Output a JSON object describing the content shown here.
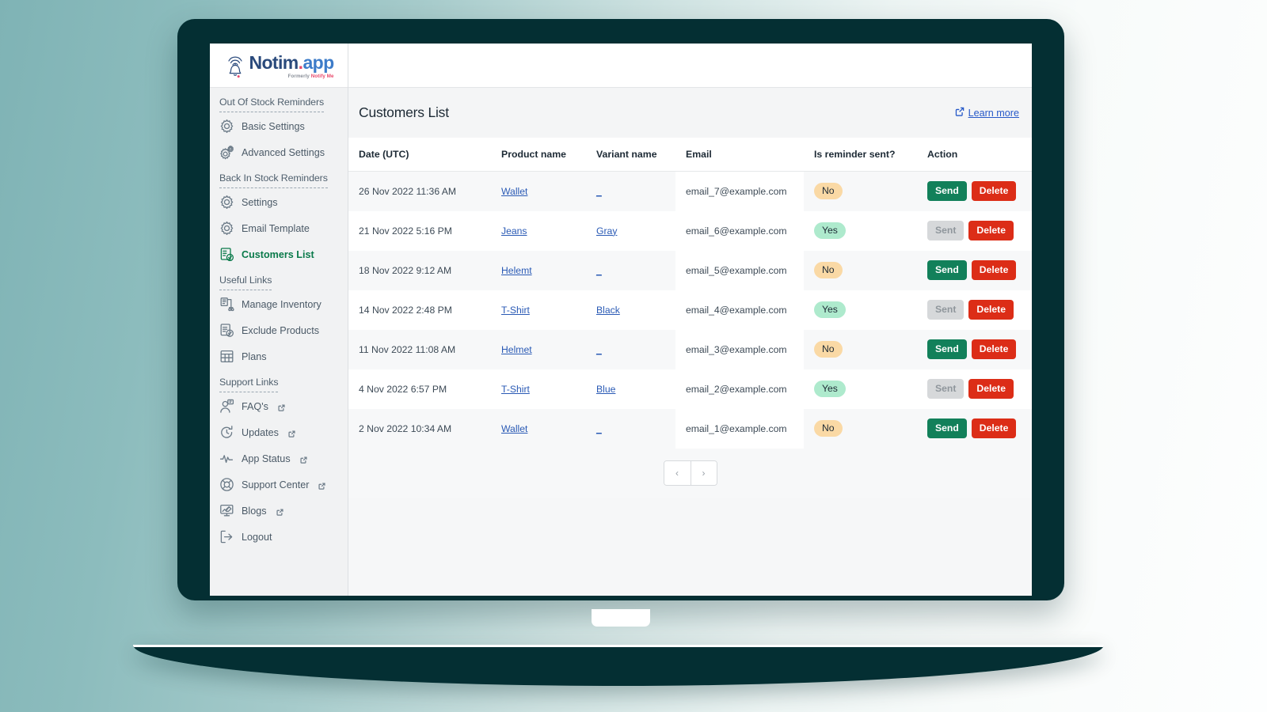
{
  "brand": {
    "name_part1": "Notim",
    "name_dot": ".",
    "name_part2": "app",
    "sub_prefix": "Formerly ",
    "sub_highlight": "Notify Me",
    "logo_icon": "bell-signal-icon"
  },
  "sidebar": {
    "groups": [
      {
        "title": "Out Of Stock Reminders",
        "items": [
          {
            "label": "Basic Settings",
            "icon": "gear-icon",
            "active": false,
            "external": false
          },
          {
            "label": "Advanced Settings",
            "icon": "gears-icon",
            "active": false,
            "external": false
          }
        ]
      },
      {
        "title": "Back In Stock Reminders",
        "items": [
          {
            "label": "Settings",
            "icon": "gear-icon",
            "active": false,
            "external": false
          },
          {
            "label": "Email Template",
            "icon": "gear-icon",
            "active": false,
            "external": false
          },
          {
            "label": "Customers List",
            "icon": "list-check-icon",
            "active": true,
            "external": false
          }
        ]
      },
      {
        "title": "Useful Links",
        "items": [
          {
            "label": "Manage Inventory",
            "icon": "inventory-icon",
            "active": false,
            "external": false
          },
          {
            "label": "Exclude Products",
            "icon": "clipboard-check-icon",
            "active": false,
            "external": false
          },
          {
            "label": "Plans",
            "icon": "grid-table-icon",
            "active": false,
            "external": false
          }
        ]
      },
      {
        "title": "Support Links",
        "items": [
          {
            "label": "FAQ's",
            "icon": "user-question-icon",
            "active": false,
            "external": true
          },
          {
            "label": "Updates",
            "icon": "refresh-clock-icon",
            "active": false,
            "external": true
          },
          {
            "label": "App Status",
            "icon": "pulse-icon",
            "active": false,
            "external": true
          },
          {
            "label": "Support Center",
            "icon": "lifebuoy-icon",
            "active": false,
            "external": true
          },
          {
            "label": "Blogs",
            "icon": "blog-monitor-icon",
            "active": false,
            "external": true
          },
          {
            "label": "Logout",
            "icon": "logout-icon",
            "active": false,
            "external": false
          }
        ]
      }
    ]
  },
  "page": {
    "title": "Customers List",
    "learn_more_label": "Learn more",
    "learn_more_icon": "external-link-icon"
  },
  "table": {
    "columns": [
      "Date (UTC)",
      "Product name",
      "Variant name",
      "Email",
      "Is reminder sent?",
      "Action"
    ],
    "rows": [
      {
        "date": "26 Nov 2022 11:36 AM",
        "product": "Wallet",
        "variant": "_",
        "email": "email_7@example.com",
        "reminder_sent": "No",
        "action_primary": "Send",
        "action_primary_state": "enabled",
        "action_delete": "Delete"
      },
      {
        "date": "21 Nov 2022 5:16 PM",
        "product": "Jeans",
        "variant": "Gray",
        "email": "email_6@example.com",
        "reminder_sent": "Yes",
        "action_primary": "Sent",
        "action_primary_state": "disabled",
        "action_delete": "Delete"
      },
      {
        "date": "18 Nov 2022 9:12 AM",
        "product": "Helemt",
        "variant": "_",
        "email": "email_5@example.com",
        "reminder_sent": "No",
        "action_primary": "Send",
        "action_primary_state": "enabled",
        "action_delete": "Delete"
      },
      {
        "date": "14 Nov 2022 2:48 PM",
        "product": "T-Shirt",
        "variant": "Black",
        "email": "email_4@example.com",
        "reminder_sent": "Yes",
        "action_primary": "Sent",
        "action_primary_state": "disabled",
        "action_delete": "Delete"
      },
      {
        "date": "11 Nov 2022 11:08 AM",
        "product": "Helmet",
        "variant": "_",
        "email": "email_3@example.com",
        "reminder_sent": "No",
        "action_primary": "Send",
        "action_primary_state": "enabled",
        "action_delete": "Delete"
      },
      {
        "date": "4 Nov 2022 6:57 PM",
        "product": "T-Shirt",
        "variant": "Blue",
        "email": "email_2@example.com",
        "reminder_sent": "Yes",
        "action_primary": "Sent",
        "action_primary_state": "disabled",
        "action_delete": "Delete"
      },
      {
        "date": "2 Nov 2022 10:34 AM",
        "product": "Wallet",
        "variant": "_",
        "email": "email_1@example.com",
        "reminder_sent": "No",
        "action_primary": "Send",
        "action_primary_state": "enabled",
        "action_delete": "Delete"
      }
    ]
  },
  "pagination": {
    "prev_label": "‹",
    "next_label": "›"
  },
  "colors": {
    "accent_green": "#12805a",
    "danger_red": "#dc2d17",
    "link_blue": "#2558c8",
    "badge_no": "#fad9a5",
    "badge_yes": "#aeeacd",
    "active_nav": "#0a7a4a",
    "laptop_shell": "#042f33"
  }
}
